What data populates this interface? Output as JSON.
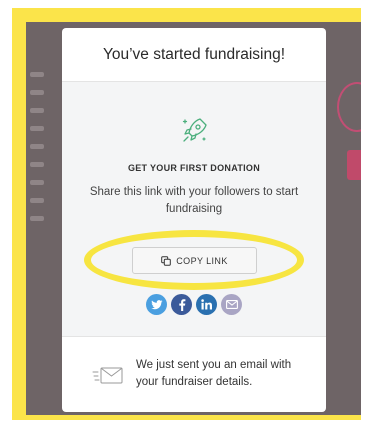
{
  "modal": {
    "title": "You’ve started fundraising!",
    "heading": "GET YOUR FIRST DONATION",
    "description": "Share this link with your followers to start fundraising",
    "copy_link_label": "COPY LINK",
    "rocket_icon": "rocket-icon",
    "copy_icon": "copy-icon"
  },
  "social": [
    {
      "name": "twitter",
      "icon": "twitter-icon",
      "color": "#4a9fe0"
    },
    {
      "name": "facebook",
      "icon": "facebook-icon",
      "color": "#3b5a9a"
    },
    {
      "name": "linkedin",
      "icon": "linkedin-icon",
      "color": "#2a70b0"
    },
    {
      "name": "email",
      "icon": "email-icon",
      "color": "#a9a5c4"
    }
  ],
  "footer": {
    "message": "We just sent you an email with your fundraiser details.",
    "icon": "mail-icon"
  },
  "colors": {
    "highlight": "#f7e541",
    "accent_green": "#4caf7d"
  }
}
